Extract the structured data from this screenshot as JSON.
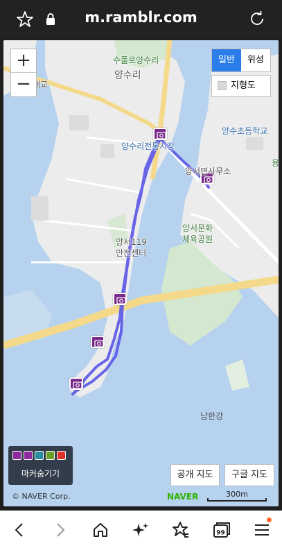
{
  "browser": {
    "url": "m.ramblr.com",
    "icons": [
      "star-icon",
      "lock-icon",
      "reload-icon"
    ]
  },
  "map": {
    "zoom": {
      "plus": "+",
      "minus": "−"
    },
    "type_buttons": {
      "normal": "일반",
      "satellite": "위성"
    },
    "terrain_label": "지형도",
    "labels": {
      "supullo": "수풀로양수리",
      "yangsuri": "양수리",
      "yangsu_bridge": "양수대교",
      "yangsuri_market": "양수리전통시장",
      "yangsu_school": "양수초등학교",
      "yangseo_office": "양서면사무소",
      "yangseo_sports_1": "양서문화",
      "yangseo_sports_2": "체육공원",
      "safety_center_1": "양서119",
      "safety_center_2": "안전센터",
      "namhangang": "남한강",
      "edge_char": "용"
    },
    "legend_label": "마커숨기기",
    "legend_colors": [
      "#8e2aa0",
      "#8e2aa0",
      "#2a8ea0",
      "#6aa02a",
      "#e0302a"
    ],
    "open_map_button": "공개 지도",
    "google_map_button": "구글 지도",
    "copyright": "© NAVER Corp.",
    "naver_logo": "NAVER",
    "scale": "300m",
    "accent": "#2b7de9",
    "route_color": "#5a55e8",
    "marker_color": "#7a2a8c"
  },
  "bottom_nav": {
    "icons": [
      "back-icon",
      "forward-icon",
      "home-icon",
      "sparkle-icon",
      "bookmark-star-icon",
      "tabs-icon",
      "menu-icon"
    ],
    "tabs_count": "99"
  }
}
